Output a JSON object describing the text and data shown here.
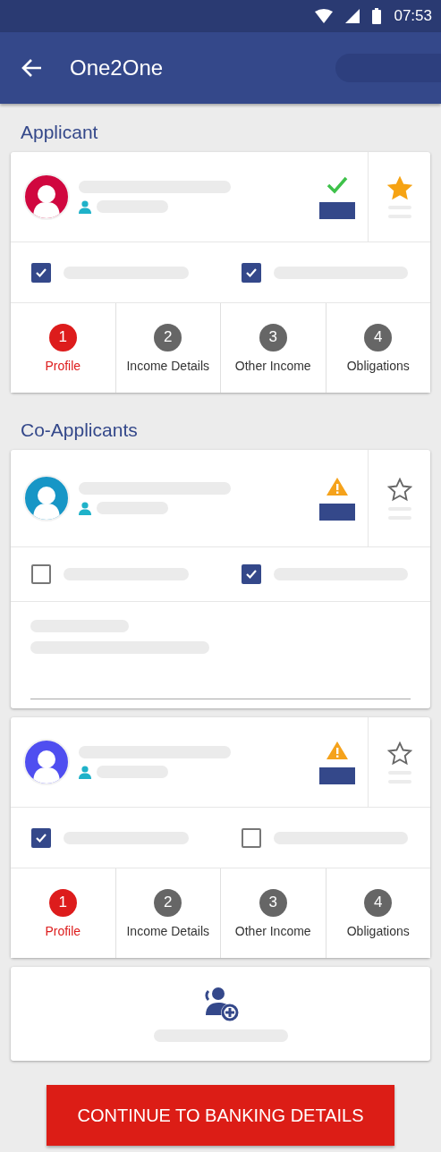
{
  "status_bar": {
    "time": "07:53"
  },
  "app_bar": {
    "title": "One2One"
  },
  "sections": [
    {
      "title": "Applicant",
      "cards": [
        {
          "kind": "steps",
          "avatar": {
            "color": "#d0073f"
          },
          "status": {
            "kind": "done"
          },
          "starred": true,
          "checkboxes": [
            {
              "checked": true
            },
            {
              "checked": true
            }
          ],
          "steps": [
            {
              "number": "1",
              "label": "Profile",
              "selected": true
            },
            {
              "number": "2",
              "label": "Income Details",
              "selected": false
            },
            {
              "number": "3",
              "label": "Other Income",
              "selected": false
            },
            {
              "number": "4",
              "label": "Obligations",
              "selected": false
            }
          ]
        }
      ]
    },
    {
      "title": "Co-Applicants",
      "cards": [
        {
          "kind": "form",
          "avatar": {
            "color": "#1796c6"
          },
          "status": {
            "kind": "warning"
          },
          "starred": false,
          "checkboxes": [
            {
              "checked": false
            },
            {
              "checked": true
            }
          ]
        },
        {
          "kind": "steps",
          "avatar": {
            "color": "#4f4ef0"
          },
          "status": {
            "kind": "warning"
          },
          "starred": false,
          "checkboxes": [
            {
              "checked": true
            },
            {
              "checked": false
            }
          ],
          "steps": [
            {
              "number": "1",
              "label": "Profile",
              "selected": true
            },
            {
              "number": "2",
              "label": "Income Details",
              "selected": false
            },
            {
              "number": "3",
              "label": "Other Income",
              "selected": false
            },
            {
              "number": "4",
              "label": "Obligations",
              "selected": false
            }
          ]
        }
      ]
    }
  ],
  "continue_button": {
    "label": "CONTINUE TO BANKING DETAILS"
  }
}
